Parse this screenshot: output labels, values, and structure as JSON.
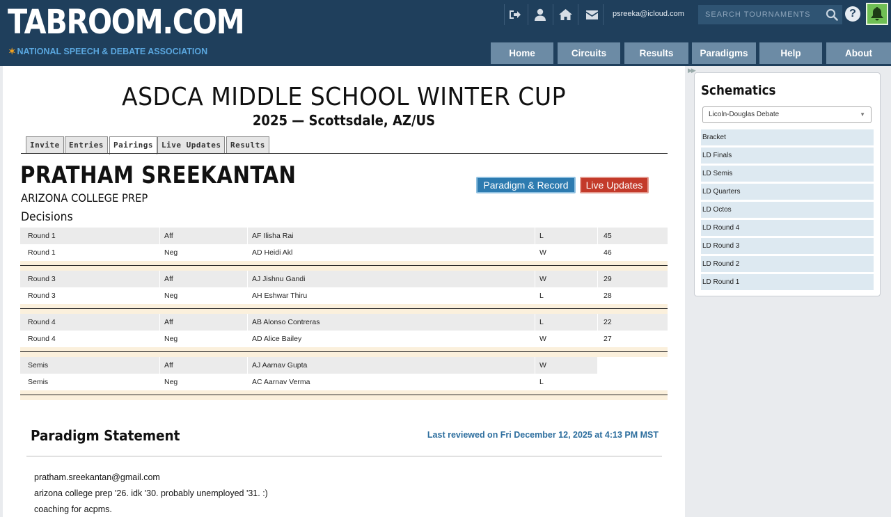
{
  "header": {
    "logo": "TABROOM.COM",
    "tagline": "NATIONAL SPEECH & DEBATE ASSOCIATION",
    "user_email": "psreeka@icloud.com",
    "search_placeholder": "SEARCH TOURNAMENTS",
    "nav": [
      "Home",
      "Circuits",
      "Results",
      "Paradigms",
      "Help",
      "About"
    ]
  },
  "tournament": {
    "title": "ASDCA MIDDLE SCHOOL WINTER CUP",
    "subtitle": "2025 — Scottsdale, AZ/US"
  },
  "tabs": [
    "Invite",
    "Entries",
    "Pairings",
    "Live Updates",
    "Results"
  ],
  "active_tab": "Pairings",
  "entrant": {
    "name": "PRATHAM SREEKANTAN",
    "school": "ARIZONA COLLEGE PREP",
    "paradigm_button": "Paradigm & Record",
    "live_button": "Live Updates"
  },
  "decisions": {
    "label": "Decisions",
    "groups": [
      [
        {
          "round": "Round 1",
          "side": "Aff",
          "opponent": "AF Ilisha Rai",
          "result": "L",
          "points": "45"
        },
        {
          "round": "Round 1",
          "side": "Neg",
          "opponent": "AD Heidi Akl",
          "result": "W",
          "points": "46"
        }
      ],
      [
        {
          "round": "Round 3",
          "side": "Aff",
          "opponent": "AJ Jishnu Gandi",
          "result": "W",
          "points": "29"
        },
        {
          "round": "Round 3",
          "side": "Neg",
          "opponent": "AH Eshwar Thiru",
          "result": "L",
          "points": "28"
        }
      ],
      [
        {
          "round": "Round 4",
          "side": "Aff",
          "opponent": "AB Alonso Contreras",
          "result": "L",
          "points": "22"
        },
        {
          "round": "Round 4",
          "side": "Neg",
          "opponent": "AD Alice Bailey",
          "result": "W",
          "points": "27"
        }
      ],
      [
        {
          "round": "Semis",
          "side": "Aff",
          "opponent": "AJ Aarnav Gupta",
          "result": "W",
          "points": ""
        },
        {
          "round": "Semis",
          "side": "Neg",
          "opponent": "AC Aarnav Verma",
          "result": "L",
          "points": ""
        }
      ]
    ]
  },
  "paradigm": {
    "title": "Paradigm Statement",
    "reviewed": "Last reviewed on Fri December 12, 2025 at 4:13 PM MST",
    "lines": [
      "pratham.sreekantan@gmail.com",
      "arizona college prep '26. idk '30. probably unemployed '31. :)",
      "coaching for acpms."
    ]
  },
  "sidebar": {
    "title": "Schematics",
    "selected_event": "Licoln-Douglas Debate",
    "items": [
      "Bracket",
      "LD Finals",
      "LD Semis",
      "LD Quarters",
      "LD Octos",
      "LD Round 4",
      "LD Round 3",
      "LD Round 2",
      "LD Round 1"
    ]
  },
  "colors": {
    "header_bg": "#1f3f5c",
    "nav_button": "#6c8ba5",
    "paradigm_button": "#2d7bb0",
    "live_button": "#c33a2a",
    "bell_button": "#6fbf54",
    "link_blue": "#2d6e9e"
  },
  "icons": [
    "logout-icon",
    "user-icon",
    "home-icon",
    "mail-icon",
    "search-icon",
    "help-icon",
    "bell-icon"
  ]
}
